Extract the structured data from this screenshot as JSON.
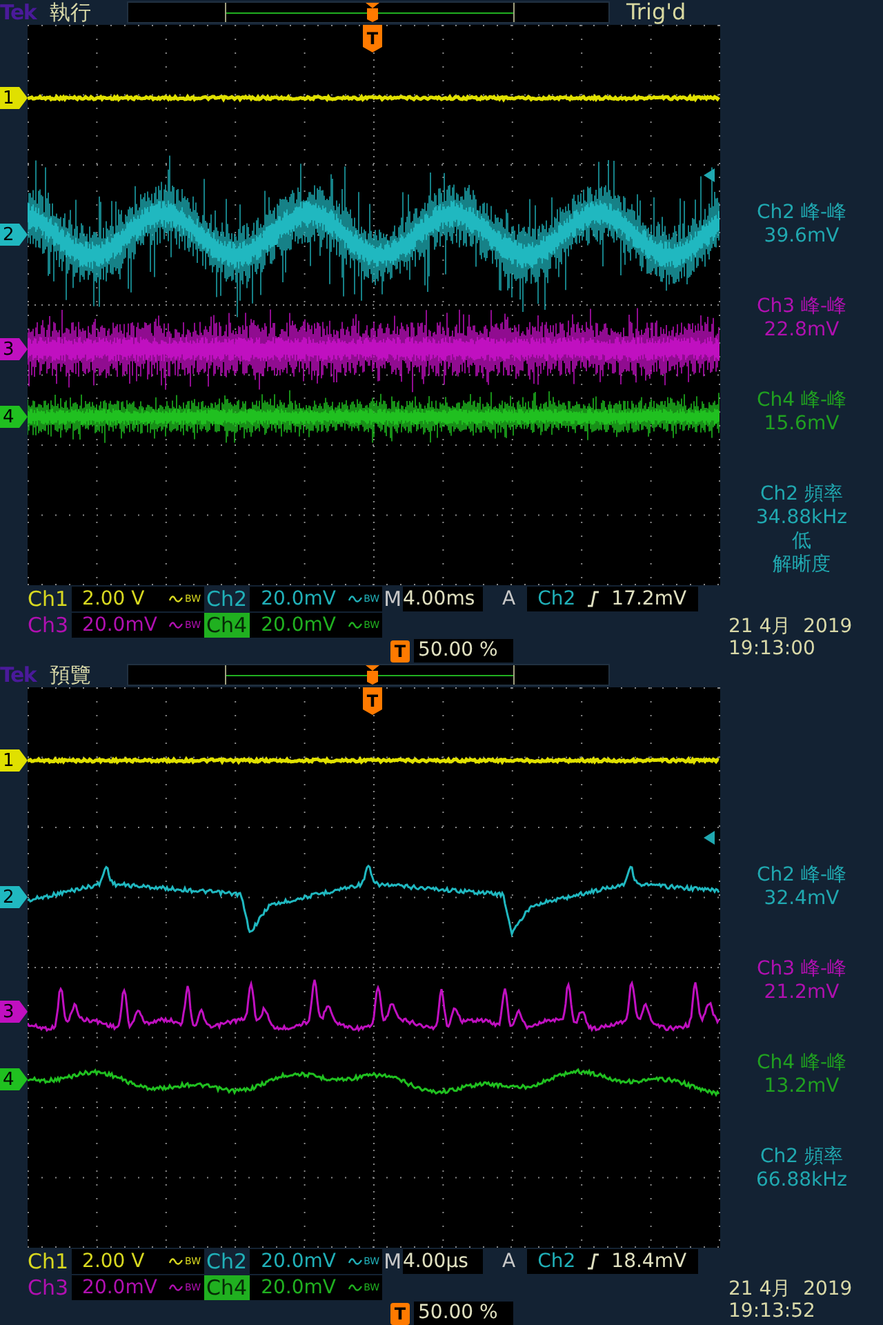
{
  "screens": [
    {
      "brand": "Tek",
      "mode": "執行",
      "trigger_status": "Trig'd",
      "trigger_marker": "T",
      "channel_markers": [
        {
          "label": "1",
          "color": "#e0e000"
        },
        {
          "label": "2",
          "color": "#20b8c0"
        },
        {
          "label": "3",
          "color": "#c010c0"
        },
        {
          "label": "4",
          "color": "#20c020"
        }
      ],
      "measurements": [
        {
          "lines": [
            "Ch2 峰-峰",
            "39.6mV"
          ],
          "color": "#20a8b0"
        },
        {
          "lines": [
            "Ch3 峰-峰",
            "22.8mV"
          ],
          "color": "#b010b0"
        },
        {
          "lines": [
            "Ch4 峰-峰",
            "15.6mV"
          ],
          "color": "#20a020"
        },
        {
          "lines": [
            "Ch2 頻率",
            "34.88kHz",
            "低",
            "解晰度"
          ],
          "color": "#20a8b0"
        }
      ],
      "readouts": {
        "channels": [
          {
            "label": "Ch1",
            "scale": "2.00 V",
            "bw": "BW",
            "color": "#d8d820",
            "selected": false
          },
          {
            "label": "Ch2",
            "scale": "20.0mV",
            "bw": "BW",
            "color": "#20b0b8",
            "selected": false
          },
          {
            "label": "Ch3",
            "scale": "20.0mV",
            "bw": "BW",
            "color": "#b010b0",
            "selected": false
          },
          {
            "label": "Ch4",
            "scale": "20.0mV",
            "bw": "BW",
            "color": "#20b020",
            "selected": true
          }
        ],
        "timebase": {
          "label": "M",
          "value": "4.00ms"
        },
        "trigger": {
          "label": "A",
          "source": "Ch2",
          "level": "17.2mV"
        },
        "trigger_position": {
          "icon": "T",
          "value": "50.00 %"
        },
        "date": "21 4月  2019",
        "time": "19:13:00"
      }
    },
    {
      "brand": "Tek",
      "mode": "預覽",
      "trigger_marker": "T",
      "channel_markers": [
        {
          "label": "1",
          "color": "#e0e000"
        },
        {
          "label": "2",
          "color": "#20b8c0"
        },
        {
          "label": "3",
          "color": "#c010c0"
        },
        {
          "label": "4",
          "color": "#20c020"
        }
      ],
      "measurements": [
        {
          "lines": [
            "Ch2 峰-峰",
            "32.4mV"
          ],
          "color": "#20a8b0"
        },
        {
          "lines": [
            "Ch3 峰-峰",
            "21.2mV"
          ],
          "color": "#b010b0"
        },
        {
          "lines": [
            "Ch4 峰-峰",
            "13.2mV"
          ],
          "color": "#20a020"
        },
        {
          "lines": [
            "Ch2 頻率",
            "66.88kHz"
          ],
          "color": "#20a8b0"
        }
      ],
      "readouts": {
        "channels": [
          {
            "label": "Ch1",
            "scale": "2.00 V",
            "bw": "BW",
            "color": "#d8d820",
            "selected": false
          },
          {
            "label": "Ch2",
            "scale": "20.0mV",
            "bw": "BW",
            "color": "#20b0b8",
            "selected": false
          },
          {
            "label": "Ch3",
            "scale": "20.0mV",
            "bw": "BW",
            "color": "#b010b0",
            "selected": false
          },
          {
            "label": "Ch4",
            "scale": "20.0mV",
            "bw": "BW",
            "color": "#20b020",
            "selected": true
          }
        ],
        "timebase": {
          "label": "M",
          "value": "4.00µs"
        },
        "trigger": {
          "label": "A",
          "source": "Ch2",
          "level": "18.4mV"
        },
        "trigger_position": {
          "icon": "T",
          "value": "50.00 %"
        },
        "date": "21 4月  2019",
        "time": "19:13:52"
      }
    }
  ]
}
